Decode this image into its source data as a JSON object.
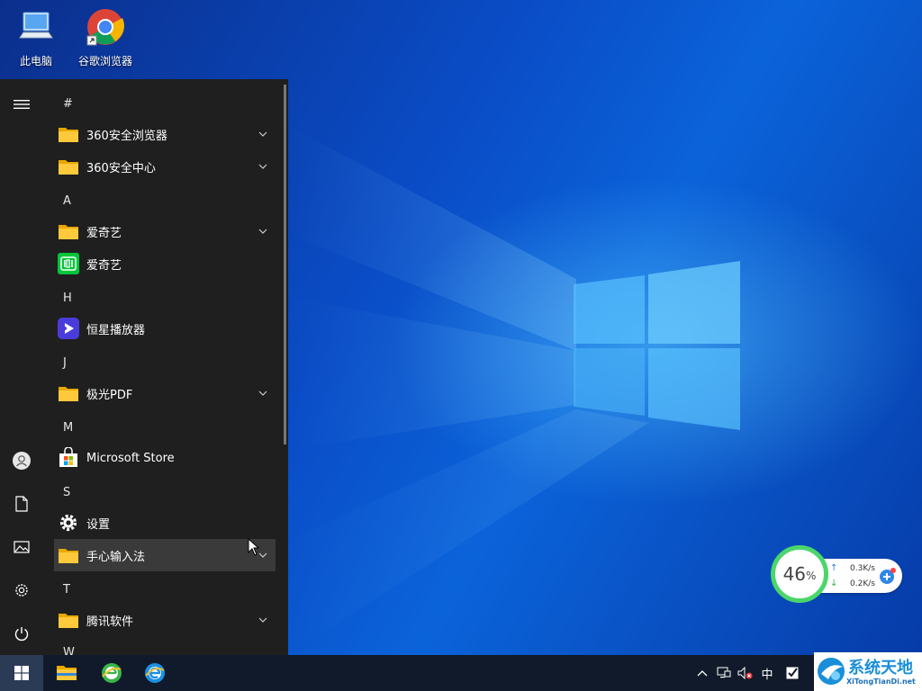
{
  "desktop": {
    "icons": [
      {
        "label": "此电脑",
        "icon": "computer-icon"
      },
      {
        "label": "谷歌浏览器",
        "icon": "chrome-icon"
      }
    ]
  },
  "start_menu": {
    "rail": [
      "menu-icon",
      "user-icon",
      "documents-icon",
      "pictures-icon",
      "settings-icon",
      "power-icon"
    ],
    "sections": [
      {
        "letter": "#"
      },
      {
        "letter": "A"
      },
      {
        "letter": "H"
      },
      {
        "letter": "J"
      },
      {
        "letter": "M"
      },
      {
        "letter": "S"
      },
      {
        "letter": "T"
      },
      {
        "letter": "W"
      }
    ],
    "items": [
      {
        "label": "360安全浏览器",
        "icon": "folder-icon",
        "expandable": true
      },
      {
        "label": "360安全中心",
        "icon": "folder-icon",
        "expandable": true
      },
      {
        "label": "爱奇艺",
        "icon": "folder-icon",
        "expandable": true
      },
      {
        "label": "爱奇艺",
        "icon": "iqiyi-icon",
        "expandable": false
      },
      {
        "label": "恒星播放器",
        "icon": "media-player-icon",
        "expandable": false
      },
      {
        "label": "极光PDF",
        "icon": "folder-icon",
        "expandable": true
      },
      {
        "label": "Microsoft Store",
        "icon": "store-icon",
        "expandable": false
      },
      {
        "label": "设置",
        "icon": "gear-icon",
        "expandable": false
      },
      {
        "label": "手心输入法",
        "icon": "folder-icon",
        "expandable": true,
        "hovered": true
      },
      {
        "label": "腾讯软件",
        "icon": "folder-icon",
        "expandable": true
      }
    ]
  },
  "network_widget": {
    "percent": "46",
    "percent_sign": "%",
    "upload": "0.3K/s",
    "download": "0.2K/s"
  },
  "taskbar": {
    "pinned": [
      "start-icon",
      "file-explorer-icon",
      "browser-green-icon",
      "edge-icon"
    ],
    "tray": {
      "ime": "中"
    }
  },
  "watermark": {
    "title": "系统天地",
    "url": "XiTongTianDi.net"
  }
}
